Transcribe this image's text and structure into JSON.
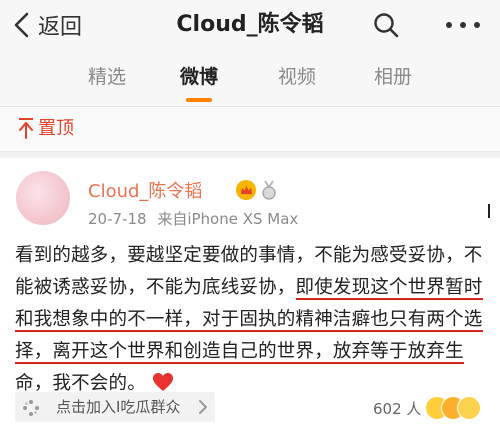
{
  "nav": {
    "back_label": "返回",
    "title": "Cloud_陈令韬"
  },
  "tabs": [
    {
      "label": "精选"
    },
    {
      "label": "微博"
    },
    {
      "label": "视频"
    },
    {
      "label": "相册"
    }
  ],
  "pinned": {
    "label": "置顶"
  },
  "post": {
    "username": "Cloud_陈令韬",
    "date": "20-7-18",
    "source": "来自iPhone XS Max",
    "text_plain": "看到的越多，要越坚定要做的事情，不能为感受妥协，不能被诱惑妥协，不能为底线妥协，",
    "text_highlight": "即使发现这个世界暂时和我想象中的不一样，对于固执的精神洁癖也只有两个选择，离开这个世界和创造自己的世界，放弃等于放弃生命，我不会的",
    "text_end": "。"
  },
  "footer": {
    "group_label": "点击加入I吃瓜群众",
    "count": "602 人"
  },
  "colors": {
    "accent_orange": "#ff8200",
    "username": "#eb7350",
    "pinned_red": "#e4422b",
    "underline_red": "#d9241b"
  },
  "icons": [
    "back-chevron-icon",
    "search-icon",
    "more-icon",
    "pin-icon",
    "vip-crown-icon",
    "medal-icon",
    "heart-icon",
    "group-icon",
    "chevron-right-icon"
  ]
}
